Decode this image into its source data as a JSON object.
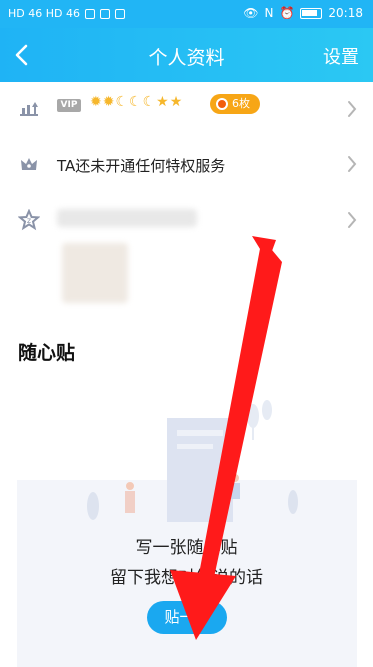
{
  "status_bar": {
    "left_text": "HD 46 HD 46",
    "right_time": "20:18"
  },
  "header": {
    "title": "个人资料",
    "settings_label": "设置"
  },
  "vip_row": {
    "badge": "VIP",
    "coins_label": "6枚"
  },
  "privilege_row": {
    "text": "TA还未开通任何特权服务"
  },
  "sticker_section": {
    "title": "随心贴",
    "empty_line1": "写一张随心贴",
    "empty_line2": "留下我想对你说的话",
    "button_label": "贴一个"
  },
  "colors": {
    "brand": "#21b5f5",
    "coin": "#f7a616",
    "annotation_arrow": "#ff1a1a"
  }
}
